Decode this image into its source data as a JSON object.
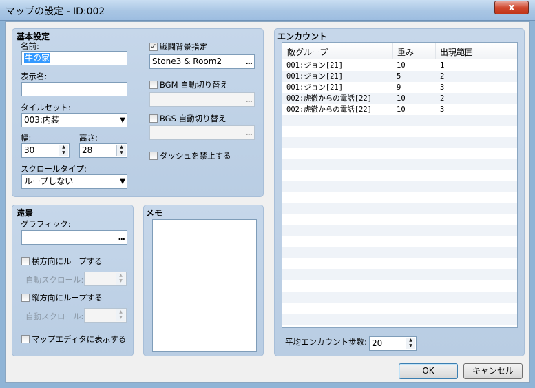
{
  "window": {
    "title": "マップの設定 - ID:002",
    "close_label": "x"
  },
  "basic": {
    "group": "基本設定",
    "name_label": "名前:",
    "name_value": "牛の家",
    "display_name_label": "表示名:",
    "display_name_value": "",
    "tileset_label": "タイルセット:",
    "tileset_value": "003:内装",
    "width_label": "幅:",
    "width_value": "30",
    "height_label": "高さ:",
    "height_value": "28",
    "scroll_label": "スクロールタイプ:",
    "scroll_value": "ループしない",
    "battleback_label": "戦闘背景指定",
    "battleback_checked": true,
    "battleback_value": "Stone3 & Room2",
    "bgm_label": "BGM 自動切り替え",
    "bgm_checked": false,
    "bgm_value": "",
    "bgs_label": "BGS 自動切り替え",
    "bgs_checked": false,
    "bgs_value": "",
    "dash_label": "ダッシュを禁止する",
    "dash_checked": false,
    "browse_glyph": "..."
  },
  "parallax": {
    "group": "遠景",
    "graphic_label": "グラフィック:",
    "graphic_value": "",
    "hloop_label": "横方向にループする",
    "hscroll_label": "自動スクロール:",
    "hscroll_value": "",
    "vloop_label": "縦方向にループする",
    "vscroll_label": "自動スクロール:",
    "vscroll_value": "",
    "show_editor_label": "マップエディタに表示する"
  },
  "memo": {
    "group": "メモ",
    "value": ""
  },
  "encounter": {
    "group": "エンカウント",
    "columns": [
      "敵グループ",
      "重み",
      "出現範囲"
    ],
    "rows": [
      [
        "001:ジョン[21]",
        "10",
        "1"
      ],
      [
        "001:ジョン[21]",
        "5",
        "2"
      ],
      [
        "001:ジョン[21]",
        "9",
        "3"
      ],
      [
        "002:虎徹からの電話[22]",
        "10",
        "2"
      ],
      [
        "002:虎徹からの電話[22]",
        "10",
        "3"
      ]
    ],
    "steps_label": "平均エンカウント歩数:",
    "steps_value": "20"
  },
  "buttons": {
    "ok": "OK",
    "cancel": "キャンセル"
  }
}
